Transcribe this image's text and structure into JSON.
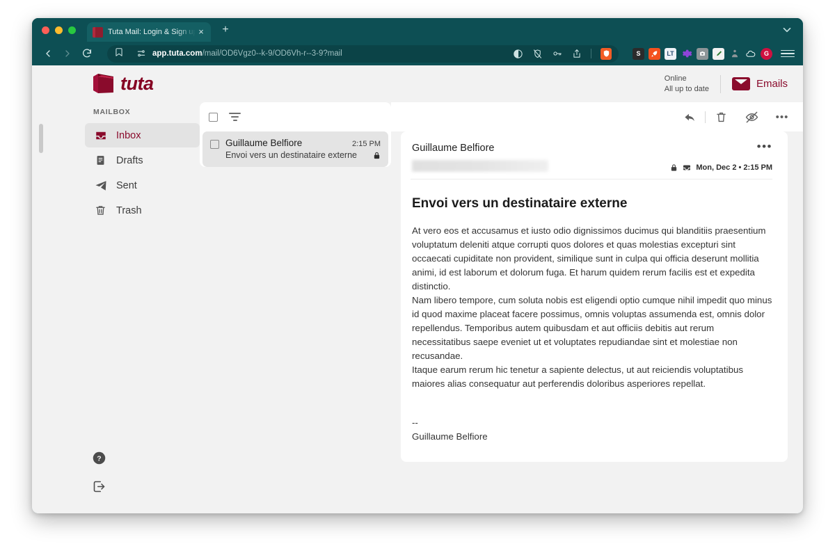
{
  "browser": {
    "tab": {
      "title": "Tuta Mail: Login & Sign up for f",
      "close_label": "×"
    },
    "new_tab_label": "+",
    "url_bold": "app.tuta.com",
    "url_rest": "/mail/OD6Vgz0--k-9/OD6Vh-r--3-9?mail",
    "extensions": [
      {
        "name": "s-extension",
        "label": "S",
        "color": "#2b2b2b"
      },
      {
        "name": "rocket-extension",
        "label": "",
        "color": "#f4511e"
      },
      {
        "name": "languagetool-extension",
        "label": "LT",
        "color": "#2b4f73"
      },
      {
        "name": "gear-extension",
        "label": "",
        "color": "#8e44d8"
      },
      {
        "name": "camera-extension",
        "label": "",
        "color": "#8d9598"
      },
      {
        "name": "highlighter-extension",
        "label": "",
        "color": "#f0f0f0"
      },
      {
        "name": "person-extension",
        "label": "",
        "color": "#8d9598"
      },
      {
        "name": "cloud-extension",
        "label": "",
        "color": "#0d4f54"
      },
      {
        "name": "g-extension",
        "label": "G",
        "color": "#cf1040"
      }
    ]
  },
  "app": {
    "logo_text": "tuta",
    "status": {
      "line1": "Online",
      "line2": "All up to date"
    },
    "emails_label": "Emails"
  },
  "sidebar": {
    "section_label": "MAILBOX",
    "items": [
      {
        "label": "Inbox",
        "icon": "inbox-icon",
        "active": true
      },
      {
        "label": "Drafts",
        "icon": "drafts-icon",
        "active": false
      },
      {
        "label": "Sent",
        "icon": "sent-icon",
        "active": false
      },
      {
        "label": "Trash",
        "icon": "trash-icon",
        "active": false
      }
    ],
    "footer": [
      {
        "name": "help-icon"
      },
      {
        "name": "logout-icon"
      }
    ]
  },
  "list": {
    "toolbar": {
      "select_all": "select-all-checkbox",
      "filter": "filter-icon"
    },
    "actions": [
      {
        "name": "reply-button",
        "icon": "reply-icon"
      },
      {
        "name": "delete-button",
        "icon": "trash-icon"
      },
      {
        "name": "mark-unread-button",
        "icon": "eye-off-icon"
      },
      {
        "name": "more-button",
        "icon": "more-horizontal-icon"
      }
    ],
    "emails": [
      {
        "sender": "Guillaume Belfiore",
        "subject": "Envoi vers un destinataire externe",
        "time": "2:15 PM",
        "encrypted": true,
        "selected": true
      }
    ]
  },
  "detail": {
    "sender": "Guillaume Belfiore",
    "address_redacted": true,
    "date": "Mon, Dec 2 • 2:15 PM",
    "subject": "Envoi vers un destinataire externe",
    "paragraphs": [
      "At vero eos et accusamus et iusto odio dignissimos ducimus qui blanditiis praesentium voluptatum deleniti atque corrupti quos dolores et quas molestias excepturi sint occaecati cupiditate non provident, similique sunt in culpa qui officia deserunt mollitia animi, id est laborum et dolorum fuga. Et harum quidem rerum facilis est et expedita distinctio.",
      "Nam libero tempore, cum soluta nobis est eligendi optio cumque nihil impedit quo minus id quod maxime placeat facere possimus, omnis voluptas assumenda est, omnis dolor repellendus. Temporibus autem quibusdam et aut officiis debitis aut rerum necessitatibus saepe eveniet ut et voluptates repudiandae sint et molestiae non recusandae.",
      "Itaque earum rerum hic tenetur a sapiente delectus, ut aut reiciendis voluptatibus maiores alias consequatur aut perferendis doloribus asperiores repellat."
    ],
    "signature_separator": "--",
    "signature_name": "Guillaume Belfiore",
    "more_label": "•••"
  },
  "colors": {
    "browser_chrome": "#0d4f54",
    "brand_red": "#8a0b2c",
    "app_bg": "#f2f2f2"
  }
}
